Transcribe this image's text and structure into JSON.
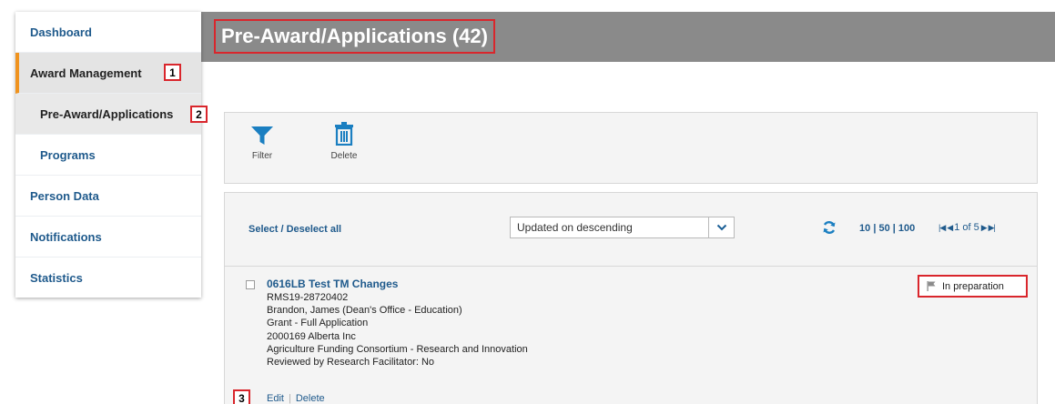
{
  "sidebar": {
    "items": [
      {
        "label": "Dashboard"
      },
      {
        "label": "Award Management",
        "badge": "1"
      },
      {
        "label": "Pre-Award/Applications",
        "badge": "2"
      },
      {
        "label": "Programs"
      },
      {
        "label": "Person Data"
      },
      {
        "label": "Notifications"
      },
      {
        "label": "Statistics"
      }
    ]
  },
  "header": {
    "title": "Pre-Award/Applications (42)"
  },
  "toolbar": {
    "filter_label": "Filter",
    "delete_label": "Delete"
  },
  "list": {
    "select_all": "Select / Deselect all",
    "sort_value": "Updated on descending",
    "page_sizes": [
      "10",
      "50",
      "100"
    ],
    "pager_text": "1 of 5"
  },
  "record": {
    "title": "0616LB Test TM Changes",
    "lines": [
      "RMS19-28720402",
      "Brandon, James (Dean's Office - Education)",
      "Grant - Full Application",
      "2000169 Alberta Inc",
      "Agriculture Funding Consortium - Research and Innovation",
      "Reviewed by Research Facilitator: No"
    ],
    "edit_label": "Edit",
    "delete_label": "Delete",
    "badge": "3",
    "status": "In preparation"
  },
  "colors": {
    "accent": "#f0931e",
    "link": "#1f5a8c",
    "icon": "#1b7fc1",
    "highlight": "#d9262c",
    "header_bg": "#8a8a8a"
  }
}
